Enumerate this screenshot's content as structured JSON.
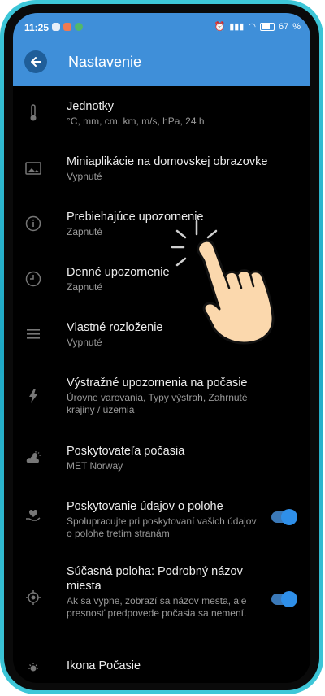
{
  "status": {
    "time": "11:25",
    "battery": "67"
  },
  "header": {
    "title": "Nastavenie"
  },
  "settings": [
    {
      "title": "Jednotky",
      "subtitle": "°C, mm, cm, km, m/s, hPa, 24 h"
    },
    {
      "title": "Miniaplikácie na domovskej obrazovke",
      "subtitle": "Vypnuté"
    },
    {
      "title": "Prebiehajúce upozornenie",
      "subtitle": "Zapnuté"
    },
    {
      "title": "Denné upozornenie",
      "subtitle": "Zapnuté"
    },
    {
      "title": "Vlastné rozloženie",
      "subtitle": "Vypnuté"
    },
    {
      "title": "Výstražné upozornenia na počasie",
      "subtitle": "Úrovne varovania, Typy výstrah, Zahrnuté krajiny / územia"
    },
    {
      "title": "Poskytovateľa počasia",
      "subtitle": "MET Norway"
    },
    {
      "title": "Poskytovanie údajov o polohe",
      "subtitle": "Spolupracujte pri poskytovaní vašich údajov o polohe tretím stranám",
      "toggle_on": true
    },
    {
      "title": "Súčasná poloha: Podrobný názov miesta",
      "subtitle": "Ak sa vypne, zobrazí sa názov mesta, ale presnosť predpovede počasia sa nemení.",
      "toggle_on": true
    },
    {
      "title": "Ikona Počasie",
      "subtitle": ""
    }
  ],
  "colors": {
    "accent": "#3f8fd9",
    "background": "#000000",
    "toggle": "#2f8fe8"
  }
}
